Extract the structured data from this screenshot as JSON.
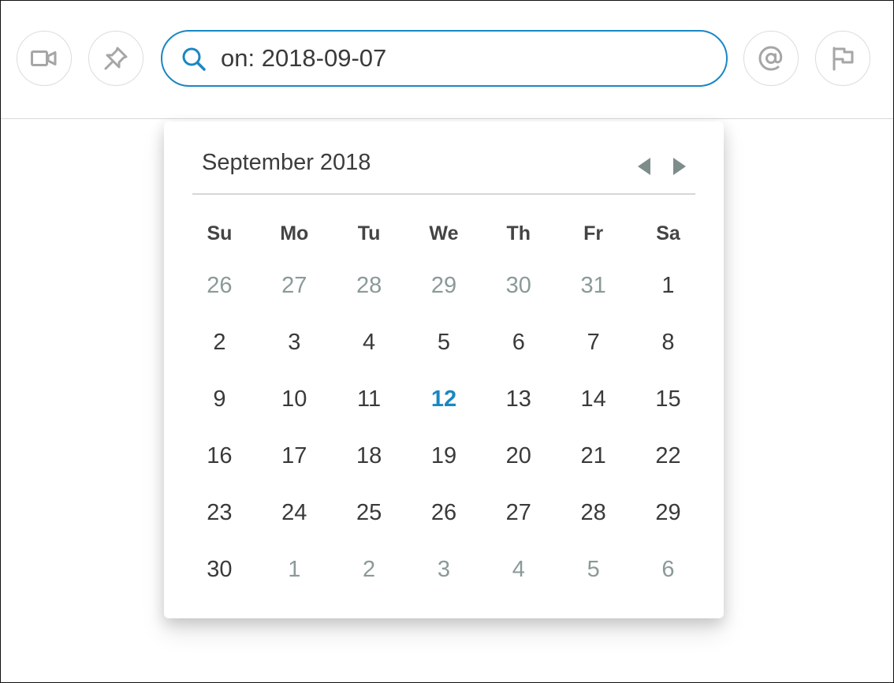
{
  "header": {
    "icons": {
      "video": "video-camera-icon",
      "pin": "pin-icon",
      "at": "at-mention-icon",
      "flag": "flag-icon"
    },
    "search": {
      "value": "on: 2018-09-07",
      "icon": "search-icon"
    }
  },
  "colors": {
    "accent": "#1a87c3",
    "text": "#3a3a3a",
    "muted": "#8a9a98",
    "nav_arrow": "#7e8c8a",
    "icon_gray": "#a6a6a6"
  },
  "calendar": {
    "title": "September 2018",
    "weekdays": [
      "Su",
      "Mo",
      "Tu",
      "We",
      "Th",
      "Fr",
      "Sa"
    ],
    "days": [
      {
        "label": "26",
        "muted": true
      },
      {
        "label": "27",
        "muted": true
      },
      {
        "label": "28",
        "muted": true
      },
      {
        "label": "29",
        "muted": true
      },
      {
        "label": "30",
        "muted": true
      },
      {
        "label": "31",
        "muted": true
      },
      {
        "label": "1"
      },
      {
        "label": "2"
      },
      {
        "label": "3"
      },
      {
        "label": "4"
      },
      {
        "label": "5"
      },
      {
        "label": "6"
      },
      {
        "label": "7"
      },
      {
        "label": "8"
      },
      {
        "label": "9"
      },
      {
        "label": "10"
      },
      {
        "label": "11"
      },
      {
        "label": "12",
        "today": true
      },
      {
        "label": "13"
      },
      {
        "label": "14"
      },
      {
        "label": "15"
      },
      {
        "label": "16"
      },
      {
        "label": "17"
      },
      {
        "label": "18"
      },
      {
        "label": "19"
      },
      {
        "label": "20"
      },
      {
        "label": "21"
      },
      {
        "label": "22"
      },
      {
        "label": "23"
      },
      {
        "label": "24"
      },
      {
        "label": "25"
      },
      {
        "label": "26"
      },
      {
        "label": "27"
      },
      {
        "label": "28"
      },
      {
        "label": "29"
      },
      {
        "label": "30"
      },
      {
        "label": "1",
        "muted": true
      },
      {
        "label": "2",
        "muted": true
      },
      {
        "label": "3",
        "muted": true
      },
      {
        "label": "4",
        "muted": true
      },
      {
        "label": "5",
        "muted": true
      },
      {
        "label": "6",
        "muted": true
      }
    ],
    "nav": {
      "prev_icon": "triangle-left-icon",
      "next_icon": "triangle-right-icon"
    }
  }
}
